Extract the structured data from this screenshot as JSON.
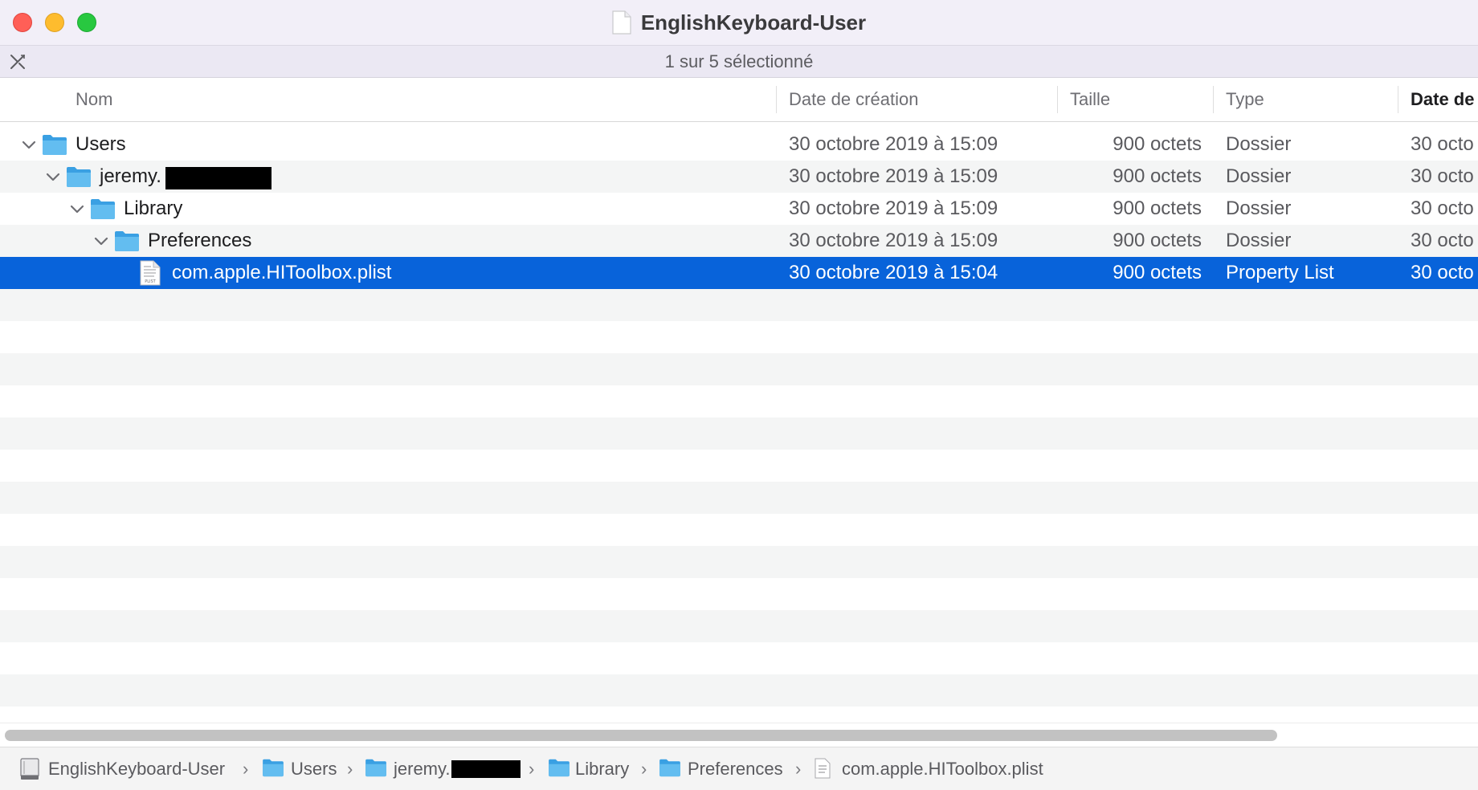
{
  "window": {
    "title": "EnglishKeyboard-User",
    "status": "1 sur 5 sélectionné"
  },
  "columns": {
    "name": "Nom",
    "created": "Date de création",
    "size": "Taille",
    "type": "Type",
    "modified": "Date de"
  },
  "rows": [
    {
      "name": "Users",
      "created": "30 octobre 2019 à 15:09",
      "size": "900 octets",
      "type": "Dossier",
      "modified": "30 octo"
    },
    {
      "name": "jeremy.",
      "created": "30 octobre 2019 à 15:09",
      "size": "900 octets",
      "type": "Dossier",
      "modified": "30 octo"
    },
    {
      "name": "Library",
      "created": "30 octobre 2019 à 15:09",
      "size": "900 octets",
      "type": "Dossier",
      "modified": "30 octo"
    },
    {
      "name": "Preferences",
      "created": "30 octobre 2019 à 15:09",
      "size": "900 octets",
      "type": "Dossier",
      "modified": "30 octo"
    },
    {
      "name": "com.apple.HIToolbox.plist",
      "created": "30 octobre 2019 à 15:04",
      "size": "900 octets",
      "type": "Property List",
      "modified": "30 octo"
    }
  ],
  "pathbar": {
    "items": [
      "EnglishKeyboard-User",
      "Users",
      "jeremy.",
      "Library",
      "Preferences",
      "com.apple.HIToolbox.plist"
    ]
  },
  "plist_icon_label": "PLIST",
  "colors": {
    "selection": "#0863da",
    "folder": "#5eb6ec",
    "close": "#ff5f57",
    "minimize": "#febc2e",
    "maximize": "#28c840"
  }
}
